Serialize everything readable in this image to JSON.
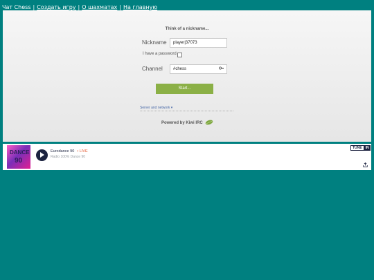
{
  "nav": {
    "items": [
      {
        "label": "Чат Chess",
        "link": false
      },
      {
        "label": "Создать игру",
        "link": true
      },
      {
        "label": "О шахматах",
        "link": true
      },
      {
        "label": "На главную",
        "link": true
      }
    ],
    "separator": "|"
  },
  "kiwi": {
    "heading": "Think of a nickname...",
    "nickname_label": "Nickname",
    "nickname_value": "player|37073",
    "password_label": "I have a password",
    "password_checked": false,
    "channel_label": "Channel",
    "channel_value": "#chess",
    "start_label": "Start...",
    "server_link": "Server and network ▾",
    "powered_by": "Powered by Kiwi IRC",
    "colors": {
      "start": "#8bb046",
      "link": "#4a6aa8"
    }
  },
  "player": {
    "art_text_1": "DANCE",
    "art_text_2": "90",
    "station": "Eurodance 90",
    "live": "• LIVE",
    "subtitle": "Radio 100% Dance 90",
    "tunein_left": "TUNE",
    "tunein_right": "IN",
    "icons": {
      "play": "play-icon",
      "share": "share-icon"
    }
  },
  "colors": {
    "background": "#008080",
    "player_dark": "#1c2340",
    "live": "#e4572e"
  }
}
